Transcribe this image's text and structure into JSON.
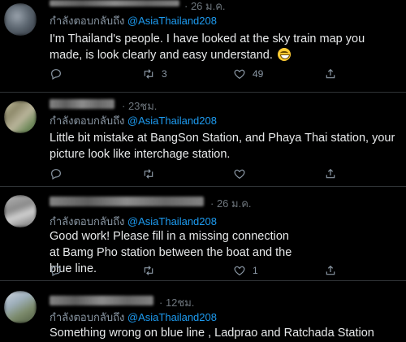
{
  "tweets": [
    {
      "time": "26 ม.ค.",
      "reply_prefix": "กำลังตอบกลับถึง",
      "reply_handle": "@AsiaThailand208",
      "text": "I'm Thailand's people. I have looked at the sky train map you made, is look clearly and easy understand.",
      "retweet_count": "3",
      "like_count": "49",
      "icons": [
        "reply-icon",
        "retweet-icon",
        "like-icon",
        "share-icon"
      ]
    },
    {
      "time": "23ชม.",
      "reply_prefix": "กำลังตอบกลับถึง",
      "reply_handle": "@AsiaThailand208",
      "text": "Little bit mistake at BangSon Station, and Phaya Thai station, your picture look like interchage station.",
      "retweet_count": "",
      "like_count": "",
      "icons": [
        "reply-icon",
        "retweet-icon",
        "like-icon",
        "share-icon"
      ]
    },
    {
      "time": "26 ม.ค.",
      "reply_prefix": "กำลังตอบกลับถึง",
      "reply_handle": "@AsiaThailand208",
      "text": "Good work!  Please fill in a missing connection at Bamg Pho station between the boat and the blue line.",
      "retweet_count": "",
      "like_count": "1",
      "icons": [
        "reply-icon",
        "retweet-icon",
        "like-icon",
        "share-icon"
      ]
    },
    {
      "time": "12ชม.",
      "reply_prefix": "กำลังตอบกลับถึง",
      "reply_handle": "@AsiaThailand208",
      "text": "Something wrong on blue line , Ladprao and Ratchada Station",
      "icons": []
    }
  ],
  "colors": {
    "background": "#000000",
    "accent": "#1d9bf0",
    "muted": "#8b98a5",
    "text": "#e7e9ea",
    "divider": "#2f3336"
  }
}
